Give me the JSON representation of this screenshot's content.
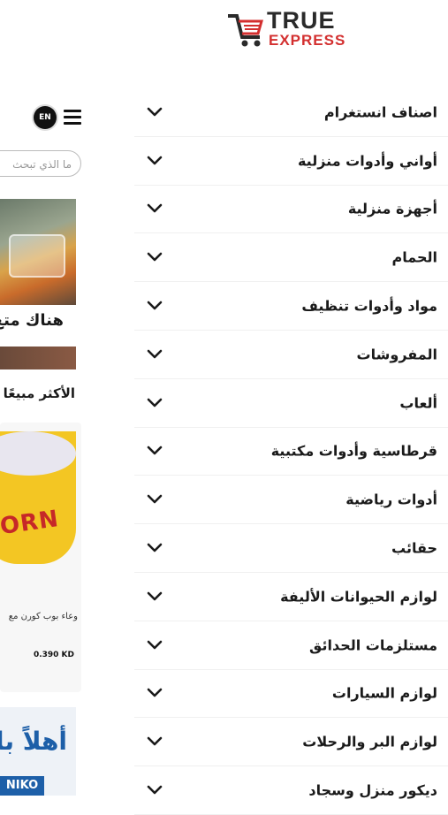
{
  "brand": {
    "name_top": "TRUE",
    "name_bottom": "EXPRESS",
    "red": "#d32f2f",
    "dark": "#2a2a2a"
  },
  "header": {
    "lang_label": "EN"
  },
  "search": {
    "placeholder": "ما الذي تبحث"
  },
  "hero": {
    "title": "هناك متع"
  },
  "sections": {
    "bestseller": "الأكثر مبيعًا"
  },
  "product": {
    "image_text": "CORN",
    "name": "وعاء بوب كورن مع",
    "price": "0.390 KD"
  },
  "welcome": {
    "text": "أهلاً بك",
    "brand_strip": "NIKO"
  },
  "categories": [
    {
      "label": "اصناف انستغرام"
    },
    {
      "label": "أواني وأدوات منزلية"
    },
    {
      "label": "أجهزة منزلية"
    },
    {
      "label": "الحمام"
    },
    {
      "label": "مواد وأدوات تنظيف"
    },
    {
      "label": "المفروشات"
    },
    {
      "label": "ألعاب"
    },
    {
      "label": "قرطاسية وأدوات مكتبية"
    },
    {
      "label": "أدوات رياضية"
    },
    {
      "label": "حقائب"
    },
    {
      "label": "لوازم الحيوانات الأليفة"
    },
    {
      "label": "مستلزمات الحدائق"
    },
    {
      "label": "لوازم السيارات"
    },
    {
      "label": "لوازم البر والرحلات"
    },
    {
      "label": "ديكور منزل وسجاد"
    }
  ]
}
